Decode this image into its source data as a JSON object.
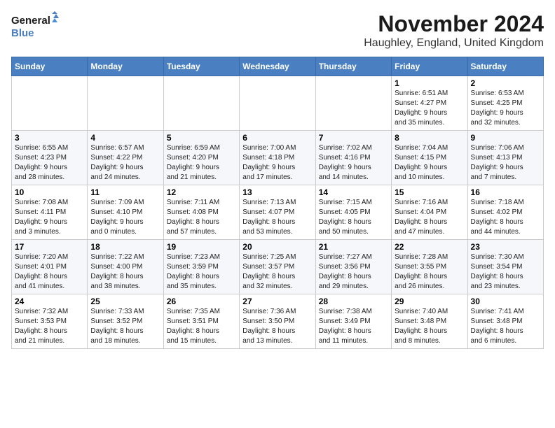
{
  "header": {
    "logo_line1": "General",
    "logo_line2": "Blue",
    "month": "November 2024",
    "location": "Haughley, England, United Kingdom"
  },
  "days_of_week": [
    "Sunday",
    "Monday",
    "Tuesday",
    "Wednesday",
    "Thursday",
    "Friday",
    "Saturday"
  ],
  "weeks": [
    [
      {
        "day": "",
        "info": ""
      },
      {
        "day": "",
        "info": ""
      },
      {
        "day": "",
        "info": ""
      },
      {
        "day": "",
        "info": ""
      },
      {
        "day": "",
        "info": ""
      },
      {
        "day": "1",
        "info": "Sunrise: 6:51 AM\nSunset: 4:27 PM\nDaylight: 9 hours\nand 35 minutes."
      },
      {
        "day": "2",
        "info": "Sunrise: 6:53 AM\nSunset: 4:25 PM\nDaylight: 9 hours\nand 32 minutes."
      }
    ],
    [
      {
        "day": "3",
        "info": "Sunrise: 6:55 AM\nSunset: 4:23 PM\nDaylight: 9 hours\nand 28 minutes."
      },
      {
        "day": "4",
        "info": "Sunrise: 6:57 AM\nSunset: 4:22 PM\nDaylight: 9 hours\nand 24 minutes."
      },
      {
        "day": "5",
        "info": "Sunrise: 6:59 AM\nSunset: 4:20 PM\nDaylight: 9 hours\nand 21 minutes."
      },
      {
        "day": "6",
        "info": "Sunrise: 7:00 AM\nSunset: 4:18 PM\nDaylight: 9 hours\nand 17 minutes."
      },
      {
        "day": "7",
        "info": "Sunrise: 7:02 AM\nSunset: 4:16 PM\nDaylight: 9 hours\nand 14 minutes."
      },
      {
        "day": "8",
        "info": "Sunrise: 7:04 AM\nSunset: 4:15 PM\nDaylight: 9 hours\nand 10 minutes."
      },
      {
        "day": "9",
        "info": "Sunrise: 7:06 AM\nSunset: 4:13 PM\nDaylight: 9 hours\nand 7 minutes."
      }
    ],
    [
      {
        "day": "10",
        "info": "Sunrise: 7:08 AM\nSunset: 4:11 PM\nDaylight: 9 hours\nand 3 minutes."
      },
      {
        "day": "11",
        "info": "Sunrise: 7:09 AM\nSunset: 4:10 PM\nDaylight: 9 hours\nand 0 minutes."
      },
      {
        "day": "12",
        "info": "Sunrise: 7:11 AM\nSunset: 4:08 PM\nDaylight: 8 hours\nand 57 minutes."
      },
      {
        "day": "13",
        "info": "Sunrise: 7:13 AM\nSunset: 4:07 PM\nDaylight: 8 hours\nand 53 minutes."
      },
      {
        "day": "14",
        "info": "Sunrise: 7:15 AM\nSunset: 4:05 PM\nDaylight: 8 hours\nand 50 minutes."
      },
      {
        "day": "15",
        "info": "Sunrise: 7:16 AM\nSunset: 4:04 PM\nDaylight: 8 hours\nand 47 minutes."
      },
      {
        "day": "16",
        "info": "Sunrise: 7:18 AM\nSunset: 4:02 PM\nDaylight: 8 hours\nand 44 minutes."
      }
    ],
    [
      {
        "day": "17",
        "info": "Sunrise: 7:20 AM\nSunset: 4:01 PM\nDaylight: 8 hours\nand 41 minutes."
      },
      {
        "day": "18",
        "info": "Sunrise: 7:22 AM\nSunset: 4:00 PM\nDaylight: 8 hours\nand 38 minutes."
      },
      {
        "day": "19",
        "info": "Sunrise: 7:23 AM\nSunset: 3:59 PM\nDaylight: 8 hours\nand 35 minutes."
      },
      {
        "day": "20",
        "info": "Sunrise: 7:25 AM\nSunset: 3:57 PM\nDaylight: 8 hours\nand 32 minutes."
      },
      {
        "day": "21",
        "info": "Sunrise: 7:27 AM\nSunset: 3:56 PM\nDaylight: 8 hours\nand 29 minutes."
      },
      {
        "day": "22",
        "info": "Sunrise: 7:28 AM\nSunset: 3:55 PM\nDaylight: 8 hours\nand 26 minutes."
      },
      {
        "day": "23",
        "info": "Sunrise: 7:30 AM\nSunset: 3:54 PM\nDaylight: 8 hours\nand 23 minutes."
      }
    ],
    [
      {
        "day": "24",
        "info": "Sunrise: 7:32 AM\nSunset: 3:53 PM\nDaylight: 8 hours\nand 21 minutes."
      },
      {
        "day": "25",
        "info": "Sunrise: 7:33 AM\nSunset: 3:52 PM\nDaylight: 8 hours\nand 18 minutes."
      },
      {
        "day": "26",
        "info": "Sunrise: 7:35 AM\nSunset: 3:51 PM\nDaylight: 8 hours\nand 15 minutes."
      },
      {
        "day": "27",
        "info": "Sunrise: 7:36 AM\nSunset: 3:50 PM\nDaylight: 8 hours\nand 13 minutes."
      },
      {
        "day": "28",
        "info": "Sunrise: 7:38 AM\nSunset: 3:49 PM\nDaylight: 8 hours\nand 11 minutes."
      },
      {
        "day": "29",
        "info": "Sunrise: 7:40 AM\nSunset: 3:48 PM\nDaylight: 8 hours\nand 8 minutes."
      },
      {
        "day": "30",
        "info": "Sunrise: 7:41 AM\nSunset: 3:48 PM\nDaylight: 8 hours\nand 6 minutes."
      }
    ]
  ]
}
